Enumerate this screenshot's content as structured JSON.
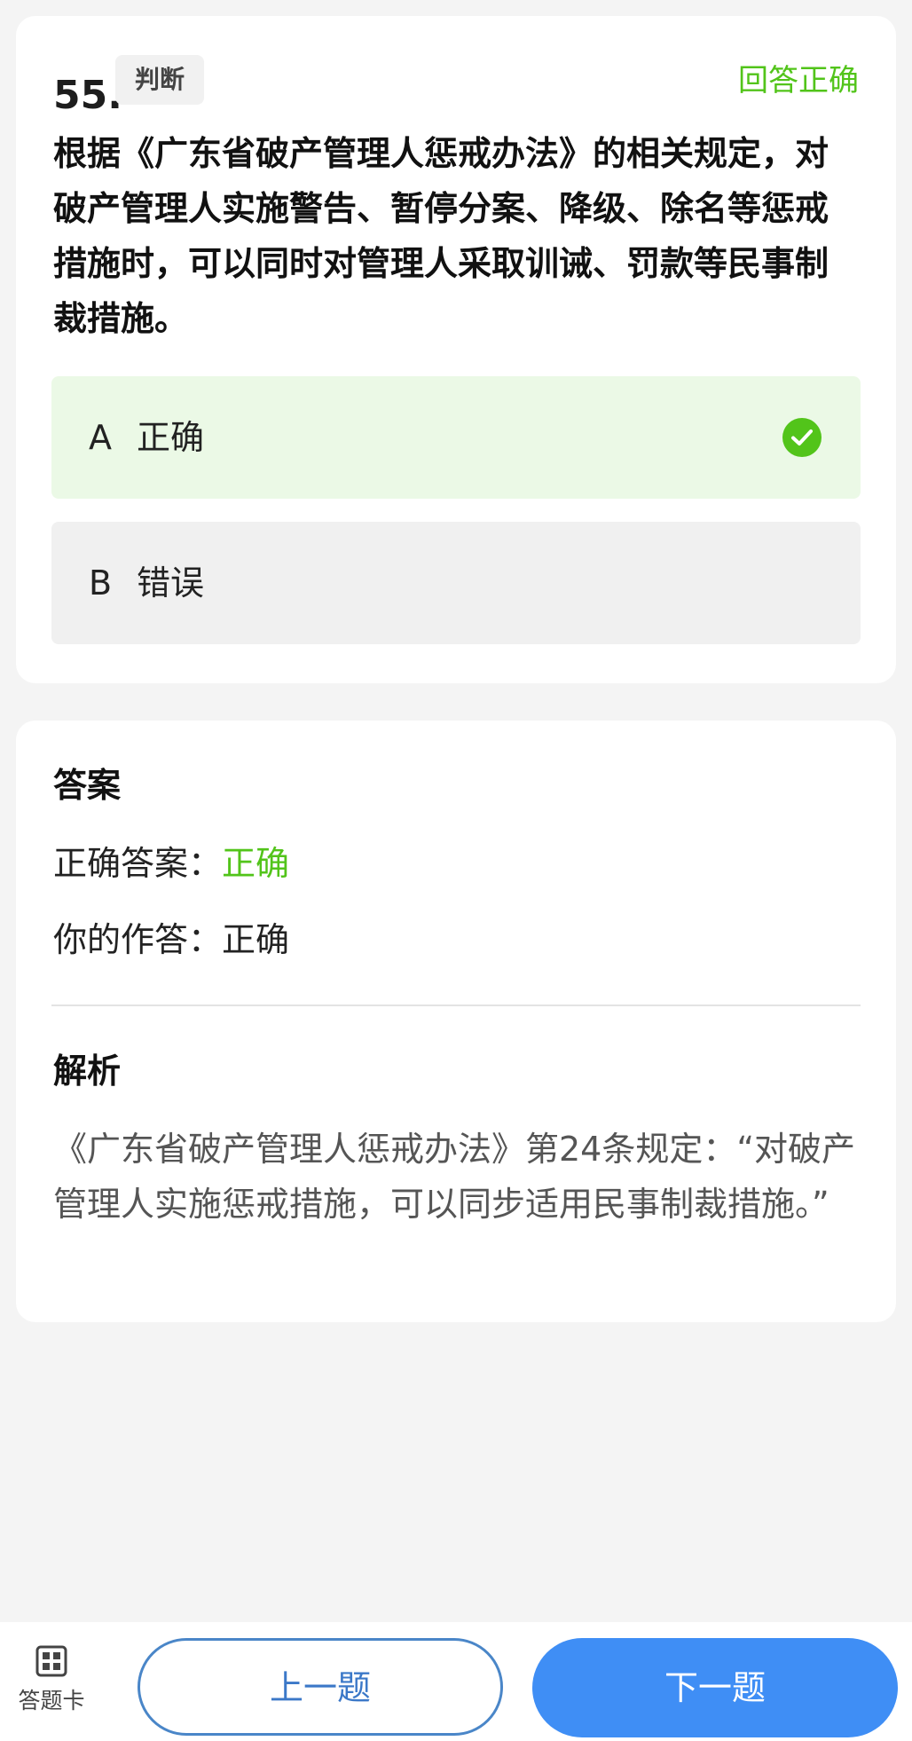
{
  "question": {
    "number": "55.",
    "type_badge": "判断",
    "status": "回答正确",
    "stem": "根据《广东省破产管理人惩戒办法》的相关规定，对破产管理人实施警告、暂停分案、降级、除名等惩戒措施时，可以同时对管理人采取训诫、罚款等民事制裁措施。",
    "options": [
      {
        "letter": "A",
        "text": "正确",
        "selected": true,
        "correct": true
      },
      {
        "letter": "B",
        "text": "错误",
        "selected": false,
        "correct": false
      }
    ]
  },
  "answer": {
    "title": "答案",
    "correct_label": "正确答案：",
    "correct_value": "正确",
    "your_label": "你的作答：",
    "your_value": "正确",
    "analysis_title": "解析",
    "analysis_text": "《广东省破产管理人惩戒办法》第24条规定：“对破产管理人实施惩戒措施，可以同步适用民事制裁措施。”"
  },
  "bottom_bar": {
    "answer_card_label": "答题卡",
    "prev_label": "上一题",
    "next_label": "下一题"
  },
  "colors": {
    "correct_green": "#52c41a",
    "selected_option_bg": "#ebf9e6",
    "primary_blue": "#3f8ef5",
    "outline_blue": "#4a86c8"
  },
  "icons": {
    "check": "check-circle-icon",
    "answer_card": "grid-icon"
  }
}
